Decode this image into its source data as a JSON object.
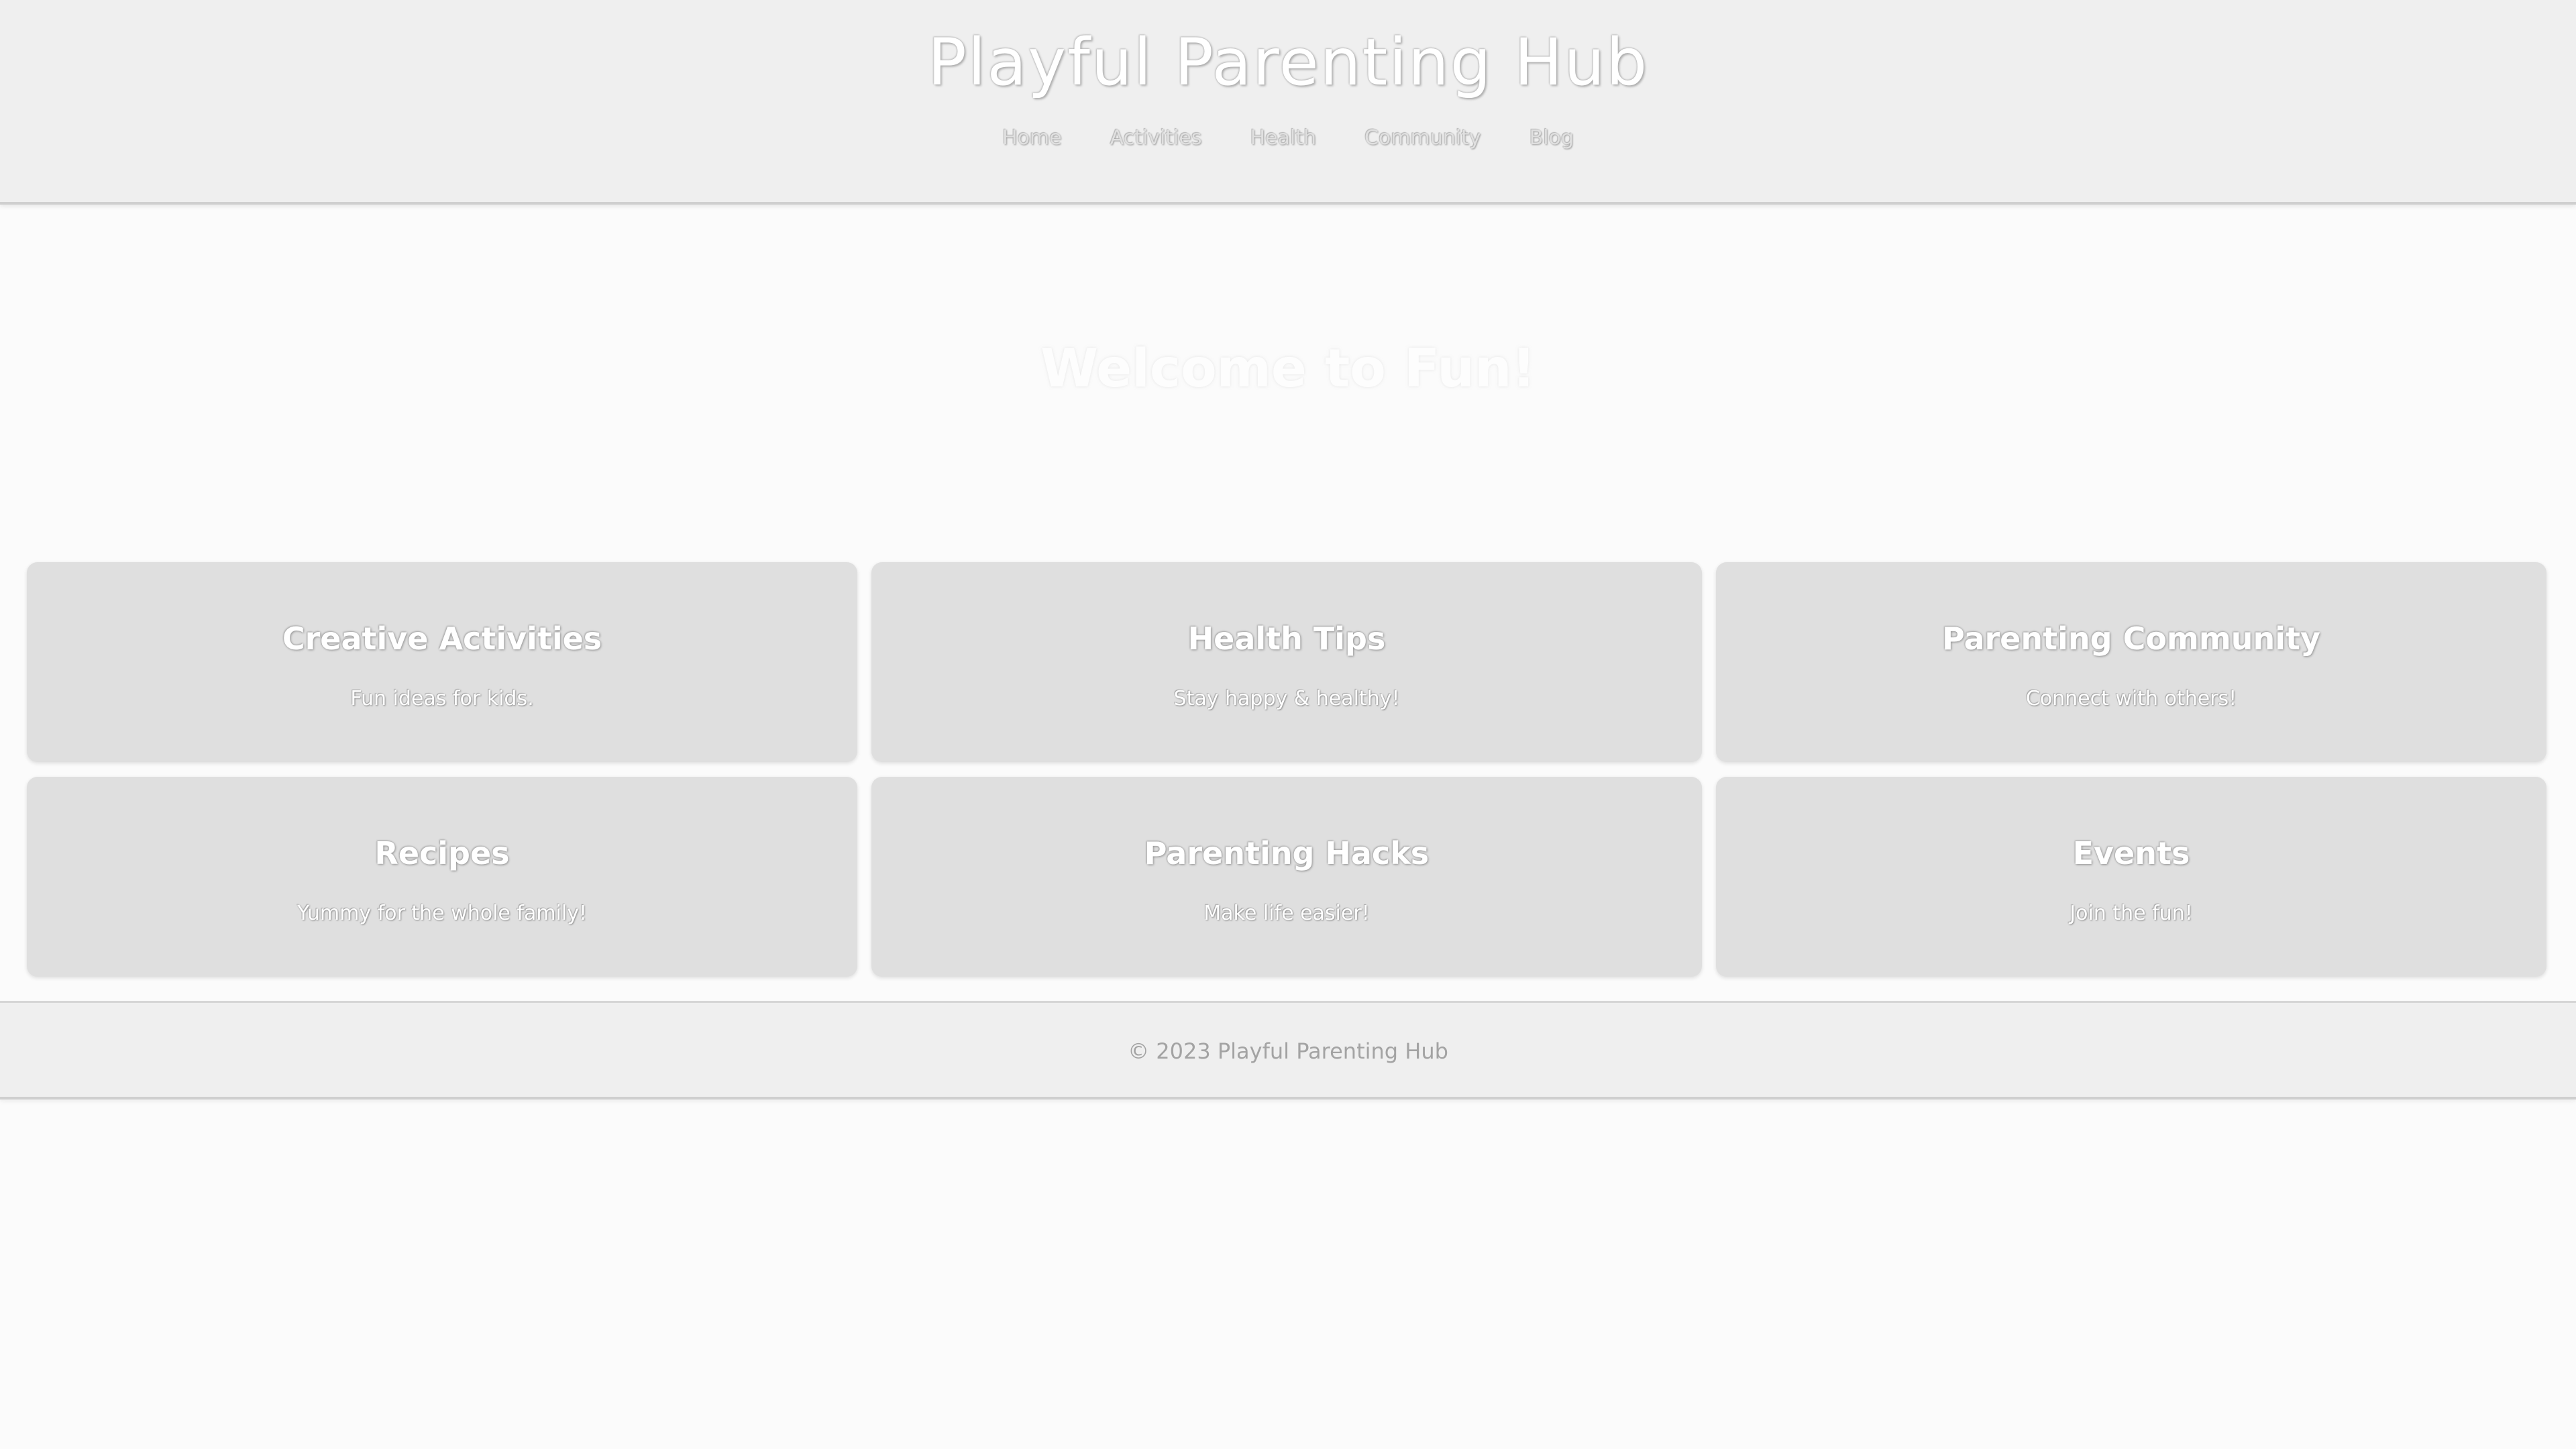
{
  "header": {
    "title": "Playful Parenting Hub",
    "nav": [
      {
        "label": "Home"
      },
      {
        "label": "Activities"
      },
      {
        "label": "Health"
      },
      {
        "label": "Community"
      },
      {
        "label": "Blog"
      }
    ]
  },
  "hero": {
    "title": "Welcome to Fun!"
  },
  "cards": [
    {
      "title": "Creative Activities",
      "text": "Fun ideas for kids."
    },
    {
      "title": "Health Tips",
      "text": "Stay happy & healthy!"
    },
    {
      "title": "Parenting Community",
      "text": "Connect with others!"
    },
    {
      "title": "Recipes",
      "text": "Yummy for the whole family!"
    },
    {
      "title": "Parenting Hacks",
      "text": "Make life easier!"
    },
    {
      "title": "Events",
      "text": "Join the fun!"
    }
  ],
  "footer": {
    "text": "© 2023 Playful Parenting Hub"
  },
  "colors": {
    "header_bg": "#efefef",
    "page_bg": "#fbfbfb",
    "card_bg": "#dfdfdf",
    "footer_text": "#a3a3a3"
  }
}
